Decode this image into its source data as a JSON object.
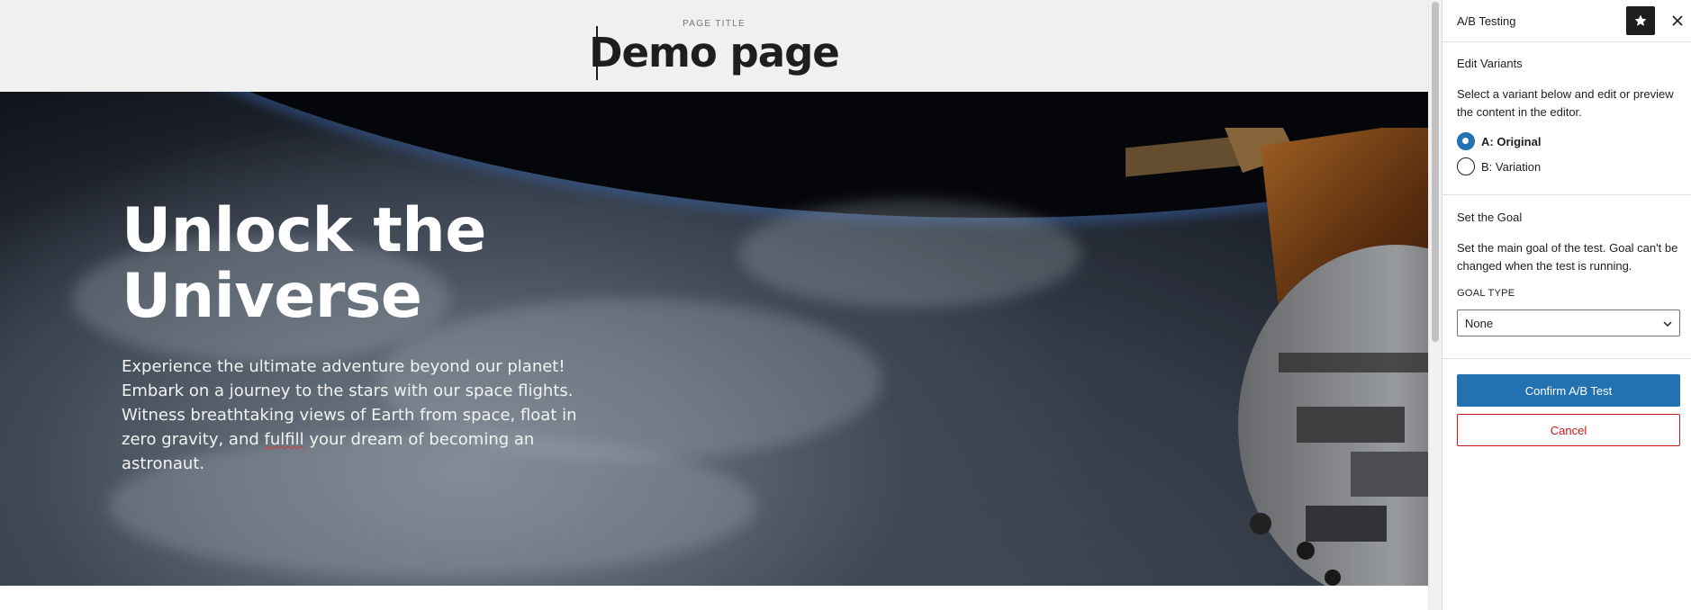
{
  "editor": {
    "page_title_label": "PAGE TITLE",
    "page_title": "Demo page"
  },
  "hero": {
    "heading": "Unlock the Universe",
    "body_before": "Experience the ultimate adventure beyond our planet! Embark on a journey to the stars with our space flights. Witness breathtaking views of Earth from space, float in zero gravity, and ",
    "body_misspelled": "fulfill",
    "body_after": " your dream of becoming an astronaut."
  },
  "sidebar": {
    "title": "A/B Testing",
    "pin_icon": "star-icon",
    "close_icon": "close-icon",
    "edit_variants": {
      "heading": "Edit Variants",
      "description": "Select a variant below and edit or preview the content in the editor.",
      "options": [
        {
          "label": "A: Original",
          "selected": true
        },
        {
          "label": "B: Variation",
          "selected": false
        }
      ]
    },
    "goal": {
      "heading": "Set the Goal",
      "description": "Set the main goal of the test. Goal can't be changed when the test is running.",
      "goal_type_label": "GOAL TYPE",
      "goal_type_value": "None"
    },
    "confirm_label": "Confirm A/B Test",
    "cancel_label": "Cancel"
  },
  "colors": {
    "accent": "#2271b1",
    "danger": "#cc1818",
    "text": "#1e1e1e"
  }
}
